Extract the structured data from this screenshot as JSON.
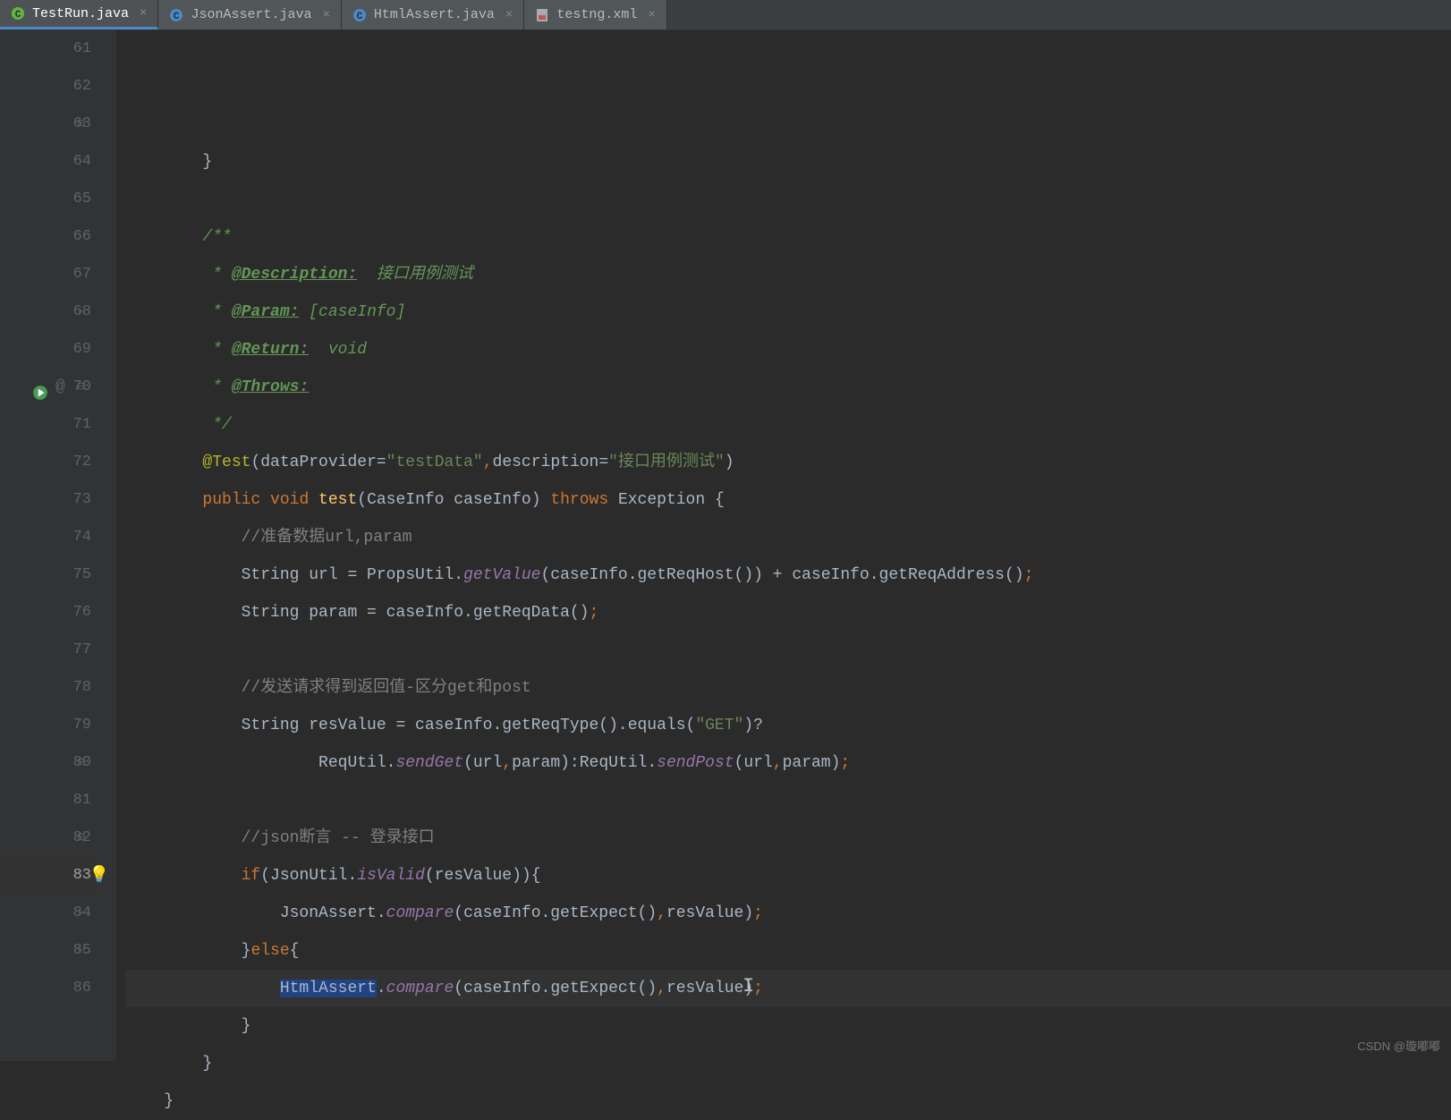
{
  "tabs": [
    {
      "label": "TestRun.java",
      "active": true,
      "icon": "java-class",
      "iconColor": "#62b543"
    },
    {
      "label": "JsonAssert.java",
      "active": false,
      "icon": "java-class",
      "iconColor": "#4a88c7"
    },
    {
      "label": "HtmlAssert.java",
      "active": false,
      "icon": "java-class",
      "iconColor": "#4a88c7"
    },
    {
      "label": "testng.xml",
      "active": false,
      "icon": "xml-file",
      "iconColor": "#c75450"
    }
  ],
  "lineStart": 61,
  "currentLine": 83,
  "code": {
    "lines": [
      {
        "n": 61,
        "fold": "close",
        "segments": [
          {
            "t": "        }",
            "c": "text"
          }
        ]
      },
      {
        "n": 62,
        "segments": []
      },
      {
        "n": 63,
        "fold": "open",
        "segments": [
          {
            "t": "        ",
            "c": "text"
          },
          {
            "t": "/**",
            "c": "javadoc"
          }
        ]
      },
      {
        "n": 64,
        "segments": [
          {
            "t": "         * ",
            "c": "javadoc"
          },
          {
            "t": "@Description:",
            "c": "javadoc-tag"
          },
          {
            "t": "  接口用例测试",
            "c": "javadoc"
          }
        ]
      },
      {
        "n": 65,
        "segments": [
          {
            "t": "         * ",
            "c": "javadoc"
          },
          {
            "t": "@Param:",
            "c": "javadoc-tag"
          },
          {
            "t": " [caseInfo]",
            "c": "javadoc"
          }
        ]
      },
      {
        "n": 66,
        "segments": [
          {
            "t": "         * ",
            "c": "javadoc"
          },
          {
            "t": "@Return:",
            "c": "javadoc-tag"
          },
          {
            "t": "  void",
            "c": "javadoc"
          }
        ]
      },
      {
        "n": 67,
        "segments": [
          {
            "t": "         * ",
            "c": "javadoc"
          },
          {
            "t": "@Throws:",
            "c": "javadoc-tag"
          }
        ]
      },
      {
        "n": 68,
        "fold": "close",
        "segments": [
          {
            "t": "         */",
            "c": "javadoc"
          }
        ]
      },
      {
        "n": 69,
        "segments": [
          {
            "t": "        ",
            "c": "text"
          },
          {
            "t": "@Test",
            "c": "annotation"
          },
          {
            "t": "(",
            "c": "text"
          },
          {
            "t": "dataProvider",
            "c": "text"
          },
          {
            "t": "=",
            "c": "text"
          },
          {
            "t": "\"testData\"",
            "c": "string"
          },
          {
            "t": ",",
            "c": "kw"
          },
          {
            "t": "description",
            "c": "text"
          },
          {
            "t": "=",
            "c": "text"
          },
          {
            "t": "\"接口用例测试\"",
            "c": "string"
          },
          {
            "t": ")",
            "c": "text"
          }
        ]
      },
      {
        "n": 70,
        "fold": "open",
        "runIcon": true,
        "atIcon": true,
        "segments": [
          {
            "t": "        ",
            "c": "text"
          },
          {
            "t": "public void ",
            "c": "kw"
          },
          {
            "t": "test",
            "c": "method"
          },
          {
            "t": "(CaseInfo caseInfo) ",
            "c": "text"
          },
          {
            "t": "throws ",
            "c": "kw"
          },
          {
            "t": "Exception {",
            "c": "text"
          }
        ]
      },
      {
        "n": 71,
        "segments": [
          {
            "t": "            ",
            "c": "text"
          },
          {
            "t": "//准备数据url,param",
            "c": "comment"
          }
        ]
      },
      {
        "n": 72,
        "segments": [
          {
            "t": "            String url = PropsUtil.",
            "c": "text"
          },
          {
            "t": "getValue",
            "c": "static-method"
          },
          {
            "t": "(caseInfo.getReqHost()) + caseInfo.getReqAddress()",
            "c": "text"
          },
          {
            "t": ";",
            "c": "kw"
          }
        ]
      },
      {
        "n": 73,
        "segments": [
          {
            "t": "            String param = caseInfo.getReqData()",
            "c": "text"
          },
          {
            "t": ";",
            "c": "kw"
          }
        ]
      },
      {
        "n": 74,
        "segments": []
      },
      {
        "n": 75,
        "segments": [
          {
            "t": "            ",
            "c": "text"
          },
          {
            "t": "//发送请求得到返回值-区分get和post",
            "c": "comment"
          }
        ]
      },
      {
        "n": 76,
        "segments": [
          {
            "t": "            String resValue = caseInfo.getReqType().equals(",
            "c": "text"
          },
          {
            "t": "\"GET\"",
            "c": "string"
          },
          {
            "t": ")?",
            "c": "text"
          }
        ]
      },
      {
        "n": 77,
        "segments": [
          {
            "t": "                    ReqUtil.",
            "c": "text"
          },
          {
            "t": "sendGet",
            "c": "static-method"
          },
          {
            "t": "(url",
            "c": "text"
          },
          {
            "t": ",",
            "c": "kw"
          },
          {
            "t": "param):ReqUtil.",
            "c": "text"
          },
          {
            "t": "sendPost",
            "c": "static-method"
          },
          {
            "t": "(url",
            "c": "text"
          },
          {
            "t": ",",
            "c": "kw"
          },
          {
            "t": "param)",
            "c": "text"
          },
          {
            "t": ";",
            "c": "kw"
          }
        ]
      },
      {
        "n": 78,
        "segments": []
      },
      {
        "n": 79,
        "segments": [
          {
            "t": "            ",
            "c": "text"
          },
          {
            "t": "//json断言 -- 登录接口",
            "c": "comment"
          }
        ]
      },
      {
        "n": 80,
        "fold": "open",
        "segments": [
          {
            "t": "            ",
            "c": "text"
          },
          {
            "t": "if",
            "c": "kw"
          },
          {
            "t": "(JsonUtil.",
            "c": "text"
          },
          {
            "t": "isValid",
            "c": "static-method"
          },
          {
            "t": "(resValue)){",
            "c": "text"
          }
        ]
      },
      {
        "n": 81,
        "segments": [
          {
            "t": "                JsonAssert.",
            "c": "text"
          },
          {
            "t": "compare",
            "c": "static-method"
          },
          {
            "t": "(caseInfo.getExpect()",
            "c": "text"
          },
          {
            "t": ",",
            "c": "kw"
          },
          {
            "t": "resValue)",
            "c": "text"
          },
          {
            "t": ";",
            "c": "kw"
          }
        ]
      },
      {
        "n": 82,
        "fold": "close-open",
        "segments": [
          {
            "t": "            }",
            "c": "text"
          },
          {
            "t": "else",
            "c": "kw"
          },
          {
            "t": "{",
            "c": "text"
          }
        ]
      },
      {
        "n": 83,
        "bulb": true,
        "current": true,
        "segments": [
          {
            "t": "                ",
            "c": "text"
          },
          {
            "t": "HtmlAssert",
            "c": "selected"
          },
          {
            "t": ".",
            "c": "text"
          },
          {
            "t": "compare",
            "c": "static-method"
          },
          {
            "t": "(caseInfo.getExpect()",
            "c": "text"
          },
          {
            "t": ",",
            "c": "kw"
          },
          {
            "t": "resValue)",
            "c": "text"
          },
          {
            "t": ";",
            "c": "kw"
          }
        ]
      },
      {
        "n": 84,
        "fold": "close",
        "segments": [
          {
            "t": "            }",
            "c": "text"
          }
        ]
      },
      {
        "n": 85,
        "fold": "close",
        "segments": [
          {
            "t": "        }",
            "c": "text"
          }
        ]
      },
      {
        "n": 86,
        "segments": [
          {
            "t": "    }",
            "c": "text"
          }
        ]
      }
    ]
  },
  "watermark": "CSDN @璇嘟嘟"
}
